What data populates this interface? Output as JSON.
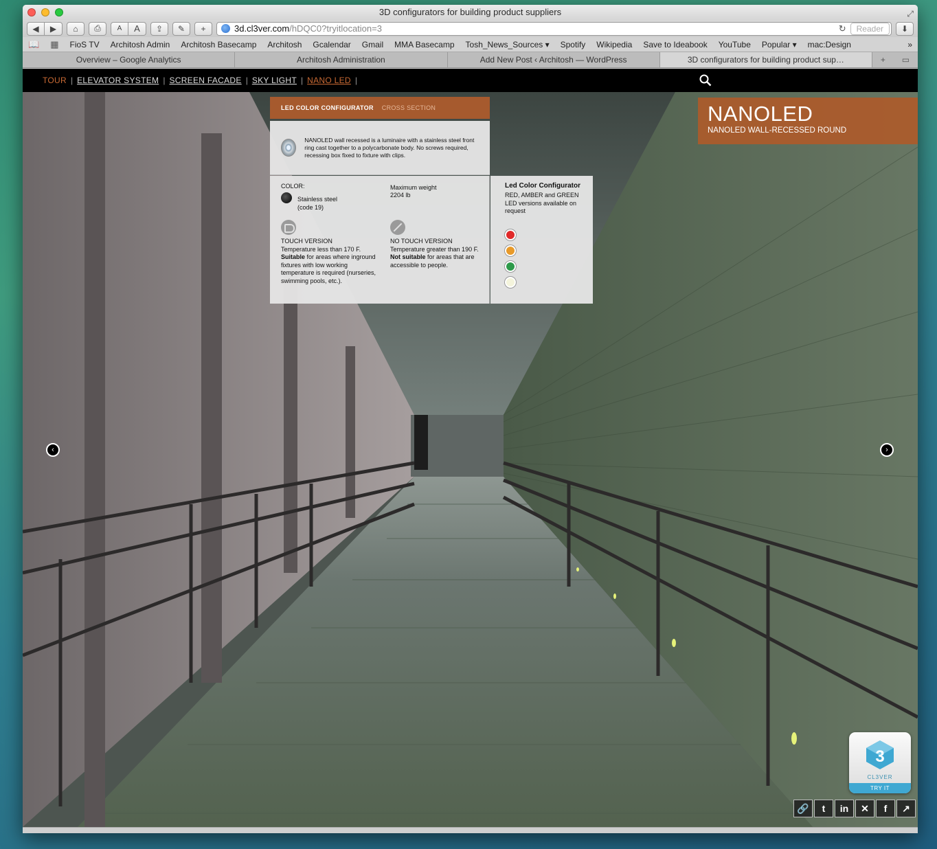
{
  "window": {
    "title": "3D configurators for building product suppliers"
  },
  "toolbar": {
    "font_small": "A",
    "font_large": "A",
    "url_host": "3d.cl3ver.com",
    "url_path": "/hDQC0?tryitlocation=3",
    "reader_label": "Reader"
  },
  "bookmarks": [
    "FioS TV",
    "Architosh Admin",
    "Architosh Basecamp",
    "Architosh",
    "Gcalendar",
    "Gmail",
    "MMA Basecamp",
    "Tosh_News_Sources ▾",
    "Spotify",
    "Wikipedia",
    "Save to Ideabook",
    "YouTube",
    "Popular ▾",
    "mac:Design"
  ],
  "tabs": [
    {
      "label": "Overview – Google Analytics"
    },
    {
      "label": "Architosh Administration"
    },
    {
      "label": "Add New Post ‹ Architosh — WordPress"
    },
    {
      "label": "3D configurators for building product sup…"
    }
  ],
  "sitenav": {
    "items": [
      "TOUR",
      "ELEVATOR SYSTEM",
      "SCREEN FACADE",
      "SKY LIGHT",
      "NANO LED"
    ],
    "separator": "|"
  },
  "panel": {
    "tab_active": "LED COLOR CONFIGURATOR",
    "tab_inactive": "CROSS SECTION",
    "description": "NANOLED  wall recessed is a luminaire with a stainless steel front ring cast together to a polycarbonate body. No screws required, recessing box fixed to fixture with clips.",
    "color_label": "COLOR:",
    "color_value": "Stainless steel",
    "color_code": "(code 19)",
    "max_weight_label": "Maximum weight",
    "max_weight_value": "2204 lb",
    "touch_title": "TOUCH VERSION",
    "touch_temp": "Temperature less than 170 F.",
    "touch_suitable": "Suitable",
    "touch_text": " for areas where inground fixtures with low working temperature is required (nurseries, swimming pools, etc.).",
    "notouch_title": "NO TOUCH VERSION",
    "notouch_temp": "Temperature greater than 190 F.",
    "notouch_not_suitable": "Not suitable",
    "notouch_text": " for areas that are accessible to people."
  },
  "configurator": {
    "title": "Led Color Configurator",
    "text": "RED, AMBER and GREEN LED versions available on request",
    "leds": [
      {
        "name": "red",
        "color": "#e02a2a"
      },
      {
        "name": "amber",
        "color": "#e89a2a"
      },
      {
        "name": "green",
        "color": "#2e9a4a"
      },
      {
        "name": "white",
        "color": "#f4f4dc"
      }
    ]
  },
  "product": {
    "name": "NANOLED",
    "subtitle": "NANOLED WALL-RECESSED ROUND"
  },
  "badge": {
    "name": "CL3VER",
    "cta": "TRY IT"
  },
  "social": [
    "link-icon",
    "twitter-icon",
    "linkedin-icon",
    "xing-icon",
    "facebook-icon",
    "external-icon"
  ],
  "colors": {
    "accent": "#a65a2e",
    "nav_active": "#c96a34"
  }
}
